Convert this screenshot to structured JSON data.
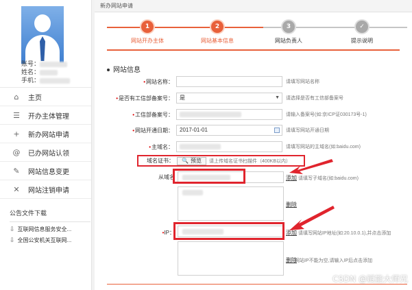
{
  "profile": {
    "account_label": "账号：",
    "name_label": "姓名：",
    "phone_label": "手机："
  },
  "menu": [
    {
      "icon": "home-icon",
      "glyph": "⌂",
      "label": "主页"
    },
    {
      "icon": "list-icon",
      "glyph": "☰",
      "label": "开办主体管理"
    },
    {
      "icon": "plus-icon",
      "glyph": "+",
      "label": "新办网站申请"
    },
    {
      "icon": "at-icon",
      "glyph": "@",
      "label": "已办网站认领"
    },
    {
      "icon": "edit-icon",
      "glyph": "✎",
      "label": "网站信息变更"
    },
    {
      "icon": "close-icon",
      "glyph": "✕",
      "label": "网站注销申请"
    }
  ],
  "downloads": {
    "title": "公告文件下载",
    "items": [
      "互联网信息服务安全...",
      "全国公安机关互联网..."
    ]
  },
  "main": {
    "title": "新办网站申请",
    "steps": [
      {
        "num": "1",
        "label": "网站开办主体",
        "state": "active"
      },
      {
        "num": "2",
        "label": "网站基本信息",
        "state": "active"
      },
      {
        "num": "3",
        "label": "网站负责人",
        "state": "todo"
      },
      {
        "num": "✓",
        "label": "提示说明",
        "state": "todo"
      }
    ],
    "section_title": "网站信息"
  },
  "form": {
    "site_name": {
      "label": "网站名称：",
      "value": "",
      "hint": "请填写网站名称"
    },
    "has_icp": {
      "label": "是否有工信部备案号：",
      "value": "是",
      "hint": "请选择是否有工信部备案号"
    },
    "icp_no": {
      "label": "工信部备案号：",
      "value": "",
      "hint": "请输入备案号(如:京ICP证030173号-1)"
    },
    "open_date": {
      "label": "网站开通日期：",
      "value": "2017-01-01",
      "hint": "请填写网站开通日期"
    },
    "main_domain": {
      "label": "主域名：",
      "value": "",
      "hint": "请填写网站的主域名(如:baidu.com)"
    },
    "cert": {
      "label": "域名证书：",
      "button": "预览",
      "hint": "请上传域名证书扫描件（400KB以内）"
    },
    "sub_domain": {
      "label": "从域名",
      "hint": "请填写子域名(如:baidu.com)",
      "add": "添加",
      "delete": "删除"
    },
    "ip": {
      "label": "IP：",
      "hint": "请填写网站IP地址(如:20.10.0.1),并点击添加",
      "add": "添加",
      "delete": "删除",
      "hint2": "网站IP不能为空,请输入IP后点击添加"
    }
  },
  "watermark": "CSDN @赋能大师兄",
  "colors": {
    "accent": "#e8603a",
    "highlight": "#e0242d",
    "pending": "#a9a9a9"
  }
}
